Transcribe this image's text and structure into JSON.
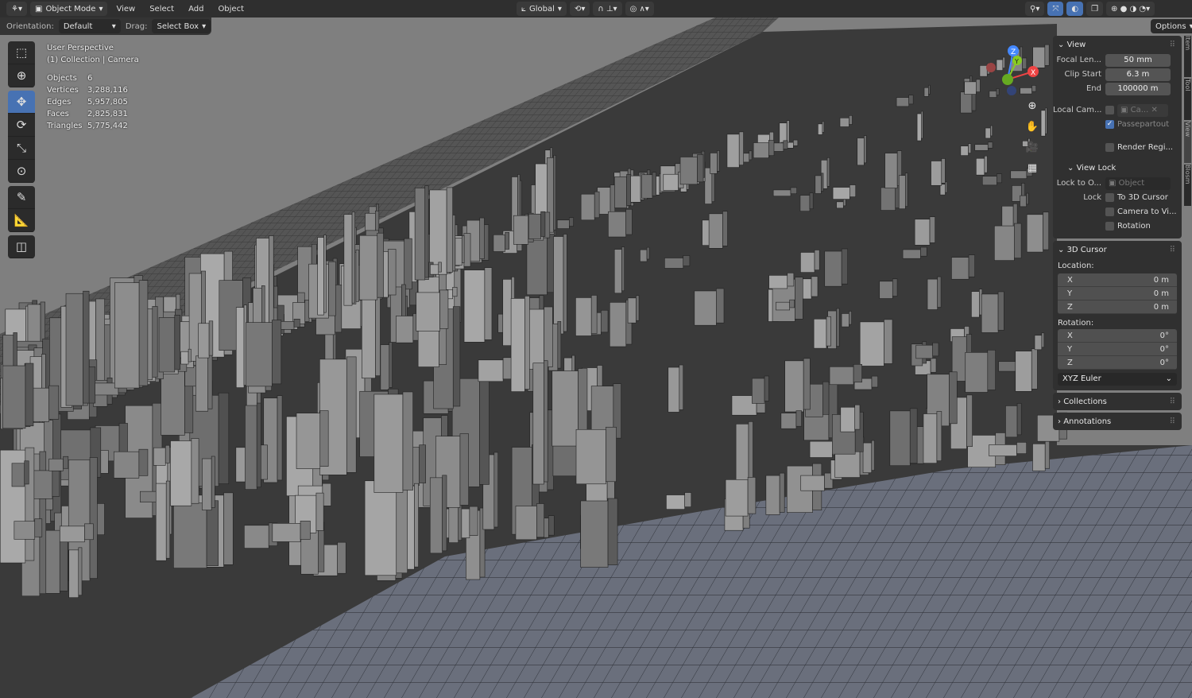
{
  "header": {
    "mode": "Object Mode",
    "menus": [
      "View",
      "Select",
      "Add",
      "Object"
    ],
    "transform_orientation": "Global",
    "options": "Options"
  },
  "tool_settings": {
    "orientation_label": "Orientation:",
    "orientation": "Default",
    "drag_label": "Drag:",
    "drag": "Select Box"
  },
  "overlay": {
    "view_name": "User Perspective",
    "collection": "(1) Collection | Camera",
    "stats": [
      {
        "k": "Objects",
        "v": "6"
      },
      {
        "k": "Vertices",
        "v": "3,288,116"
      },
      {
        "k": "Edges",
        "v": "5,957,805"
      },
      {
        "k": "Faces",
        "v": "2,825,831"
      },
      {
        "k": "Triangles",
        "v": "5,775,442"
      }
    ]
  },
  "gizmo": {
    "x": "X",
    "y": "Y",
    "z": "Z"
  },
  "sidebar": {
    "tabs": [
      "Item",
      "Tool",
      "View",
      "Blosm"
    ],
    "view": {
      "title": "View",
      "focal_label": "Focal Len...",
      "focal": "50 mm",
      "clip_start_label": "Clip Start",
      "clip_start": "6.3 m",
      "end_label": "End",
      "end": "100000 m",
      "local_cam_label": "Local Cam...",
      "local_cam": "Ca...",
      "passepartout": "Passepartout",
      "render_region": "Render Regi..."
    },
    "view_lock": {
      "title": "View Lock",
      "lock_to_label": "Lock to O...",
      "lock_to": "Object",
      "lock_label": "Lock",
      "to_cursor": "To 3D Cursor",
      "camera_to_view": "Camera to Vi...",
      "rotation": "Rotation"
    },
    "cursor": {
      "title": "3D Cursor",
      "location_label": "Location:",
      "location": [
        {
          "a": "X",
          "v": "0 m"
        },
        {
          "a": "Y",
          "v": "0 m"
        },
        {
          "a": "Z",
          "v": "0 m"
        }
      ],
      "rotation_label": "Rotation:",
      "rotation": [
        {
          "a": "X",
          "v": "0°"
        },
        {
          "a": "Y",
          "v": "0°"
        },
        {
          "a": "Z",
          "v": "0°"
        }
      ],
      "mode": "XYZ Euler"
    },
    "collections": "Collections",
    "annotations": "Annotations"
  }
}
